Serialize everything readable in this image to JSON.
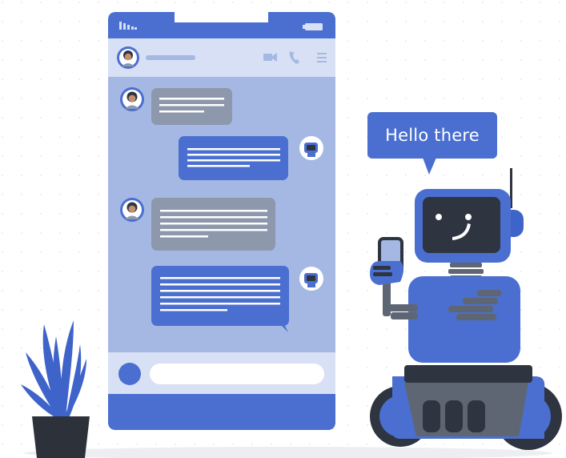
{
  "speech_bubble": {
    "text": "Hello there"
  },
  "colors": {
    "accent_blue": "#4A6FD0",
    "phone_blue": "#4A6FD0",
    "screen_bg": "#A5B8E3",
    "header_bg": "#D7E0F4",
    "grey_bubble": "#8E98AD",
    "robot_dark": "#2E3440",
    "robot_grey": "#5F6673",
    "plant_blue": "#3E63C9",
    "pot_dark": "#2C313A"
  },
  "icons": {
    "phone_header": [
      "signal-icon",
      "battery-icon",
      "avatar",
      "video-icon",
      "call-icon",
      "menu-icon"
    ],
    "composer": [
      "send-circle-icon"
    ]
  }
}
